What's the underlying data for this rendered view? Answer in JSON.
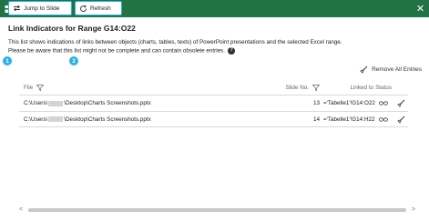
{
  "window": {
    "title": "Link Indicators",
    "close_glyph": "✕"
  },
  "heading": "Link Indicators for Range G14:O22",
  "description": {
    "line1": "This list shows indications of links between objects (charts, tables, texts) of PowerPoint presentations and the selected Excel range.",
    "line2": "Please be aware that this list might not be complete and can contain obsolete entries.",
    "help_glyph": "?"
  },
  "toolbar": {
    "jump_label": "Jump to Slide",
    "refresh_label": "Refresh",
    "remove_all_label": "Remove All Entries",
    "badge1": "1",
    "badge2": "2"
  },
  "table": {
    "headers": {
      "file": "File",
      "slide": "Slide No.",
      "linked": "Linked to",
      "status": "Status"
    },
    "rows": [
      {
        "file_prefix": "C:\\Users\\",
        "file_suffix": "\\Desktop\\Charts Screenshots.pptx",
        "slide": "13",
        "linked": "='Tabelle1'!G14:O22"
      },
      {
        "file_prefix": "C:\\Users\\",
        "file_suffix": "\\Desktop\\Charts Screenshots.pptx",
        "slide": "14",
        "linked": "='Tabelle1'!G14:H22"
      }
    ]
  },
  "scrollbar": {
    "left_glyph": "<",
    "right_glyph": ">"
  },
  "colors": {
    "titlebar": "#217346",
    "highlight": "#29b1e6"
  }
}
